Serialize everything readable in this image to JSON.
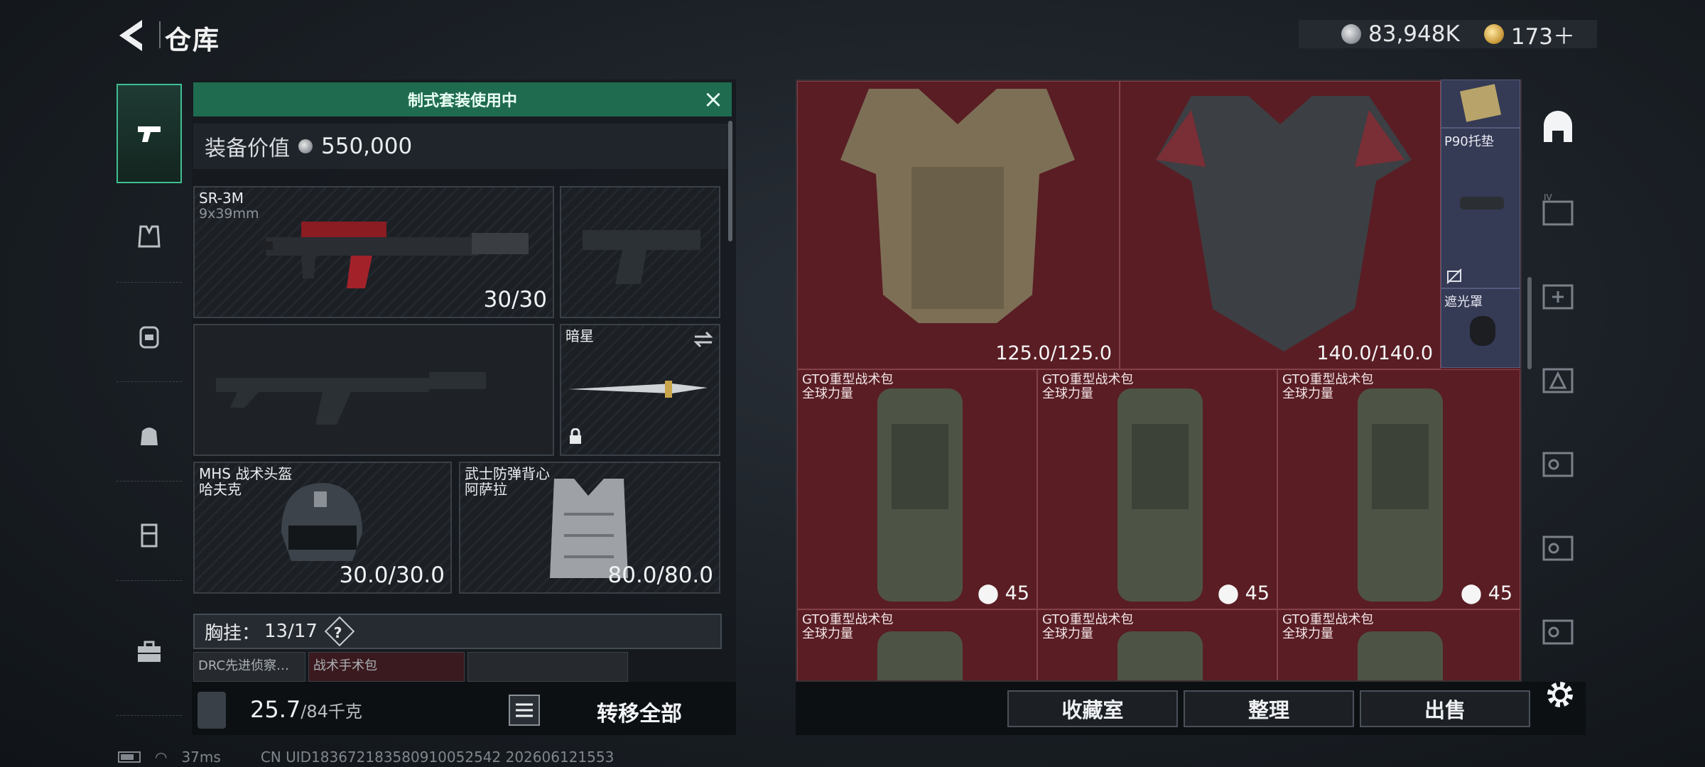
{
  "header": {
    "title": "仓库",
    "silver": "83,948K",
    "gold": "173＋"
  },
  "loadout": {
    "banner": "制式套装使用中",
    "equip_value_label": "装备价值",
    "equip_value": "550,000",
    "primary": {
      "name": "SR-3M",
      "caliber": "9x39mm",
      "ammo": "30/30"
    },
    "melee": {
      "name": "暗星"
    },
    "helmet": {
      "name": "MHS 战术头盔",
      "brand": "哈夫克",
      "durability": "30.0/30.0"
    },
    "armor": {
      "name": "武士防弹背心",
      "brand": "阿萨拉",
      "durability": "80.0/80.0"
    },
    "chest_label": "胸挂：",
    "chest_count": "13/17",
    "chest_help": "?",
    "mini_items": [
      "DRC先进侦察…",
      "战术手术包",
      ""
    ],
    "weight": "25.7",
    "weight_max": "/84千克",
    "transfer_all": "转移全部"
  },
  "stash": {
    "armor_a_durability": "125.0/125.0",
    "armor_b_durability": "140.0/140.0",
    "side_items": [
      "P90托垫",
      "遮光罩"
    ],
    "bags": [
      {
        "name": "GTO重型战术包",
        "brand": "全球力量",
        "count": "45"
      },
      {
        "name": "GTO重型战术包",
        "brand": "全球力量",
        "count": "45"
      },
      {
        "name": "GTO重型战术包",
        "brand": "全球力量",
        "count": "45"
      },
      {
        "name": "GTO重型战术包",
        "brand": "全球力量",
        "count": ""
      },
      {
        "name": "GTO重型战术包",
        "brand": "全球力量",
        "count": ""
      },
      {
        "name": "GTO重型战术包",
        "brand": "全球力量",
        "count": ""
      }
    ]
  },
  "actions": {
    "collection": "收藏室",
    "sort": "整理",
    "sell": "出售"
  },
  "status": {
    "ping": "37ms",
    "uid": "CN UID183672183580910052542 202606121553"
  },
  "colors": {
    "accent_green": "#1f6b4f",
    "stash_red": "#5e1f26",
    "side_blue": "#353a55"
  }
}
